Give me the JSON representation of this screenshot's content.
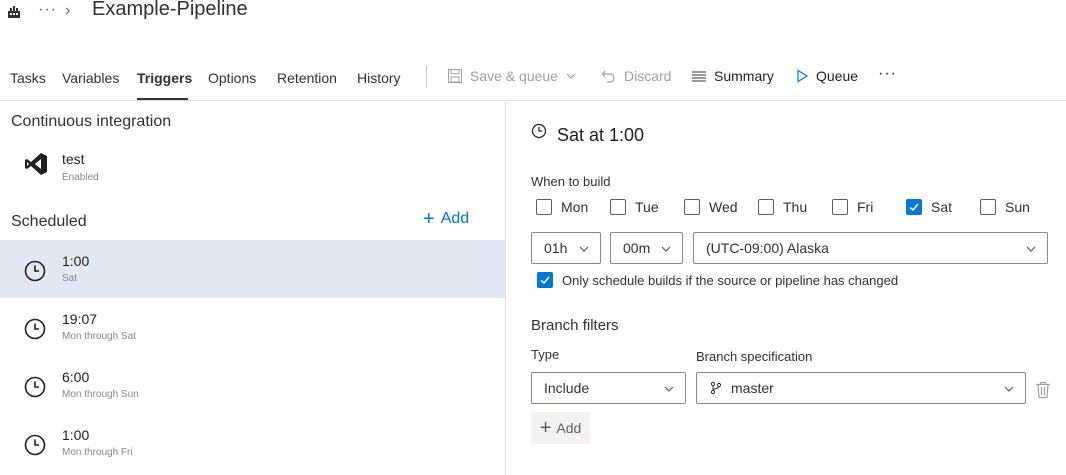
{
  "header": {
    "title": "Example-Pipeline",
    "more_label": "···",
    "chevron": "›"
  },
  "tabs": [
    {
      "label": "Tasks"
    },
    {
      "label": "Variables"
    },
    {
      "label": "Triggers",
      "active": true
    },
    {
      "label": "Options"
    },
    {
      "label": "Retention"
    },
    {
      "label": "History"
    }
  ],
  "toolbar": {
    "save_queue_label": "Save & queue",
    "discard_label": "Discard",
    "summary_label": "Summary",
    "queue_label": "Queue",
    "more_label": "···"
  },
  "left": {
    "ci_heading": "Continuous integration",
    "ci_item": {
      "title": "test",
      "status": "Enabled",
      "icon": "visual-studio-icon"
    },
    "scheduled_heading": "Scheduled",
    "add_label": "Add",
    "schedules": [
      {
        "time": "1:00",
        "days": "Sat",
        "selected": true
      },
      {
        "time": "19:07",
        "days": "Mon through Sat"
      },
      {
        "time": "6:00",
        "days": "Mon through Sun"
      },
      {
        "time": "1:00",
        "days": "Mon through Fri"
      }
    ]
  },
  "detail": {
    "title": "Sat at 1:00",
    "when_label": "When to build",
    "days": [
      {
        "label": "Mon",
        "checked": false
      },
      {
        "label": "Tue",
        "checked": false
      },
      {
        "label": "Wed",
        "checked": false
      },
      {
        "label": "Thu",
        "checked": false
      },
      {
        "label": "Fri",
        "checked": false
      },
      {
        "label": "Sat",
        "checked": true
      },
      {
        "label": "Sun",
        "checked": false
      }
    ],
    "hour": "01h",
    "minute": "00m",
    "timezone": "(UTC-09:00) Alaska",
    "only_changed_label": "Only schedule builds if the source or pipeline has changed",
    "only_changed_checked": true,
    "branch_filters_label": "Branch filters",
    "type_label": "Type",
    "branch_spec_label": "Branch specification",
    "type_value": "Include",
    "branch_value": "master",
    "add_label": "Add"
  },
  "colors": {
    "accent": "#0078d4",
    "selected_row": "#e3e8f5"
  }
}
